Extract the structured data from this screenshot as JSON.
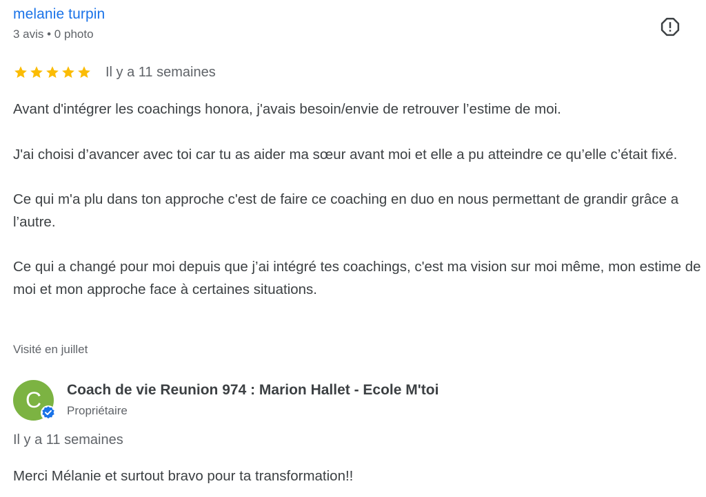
{
  "reviewer": {
    "name": "melanie turpin",
    "meta": "3 avis • 0 photo"
  },
  "report": {
    "icon": "report-icon"
  },
  "rating": {
    "value": 5,
    "max": 5,
    "star_color": "#fbbc04",
    "date": "Il y a 11 semaines"
  },
  "review": {
    "paragraphs": [
      "Avant d'intégrer les coachings honora, j'avais besoin/envie de retrouver l’estime de moi.",
      "J'ai choisi d’avancer avec toi car tu as aider ma sœur avant moi et elle a pu atteindre ce qu’elle c’était fixé.",
      "Ce qui m'a plu dans ton approche c'est de faire ce coaching en duo en nous permettant de grandir grâce a l’autre.",
      "Ce qui a changé pour moi depuis que j’ai intégré tes coachings, c'est ma vision sur moi même, mon estime de moi et mon approche face à certaines situations."
    ],
    "visited": "Visité en juillet"
  },
  "owner": {
    "avatar_letter": "C",
    "avatar_color": "#7cb342",
    "badge_color": "#1a73e8",
    "name": "Coach de vie Reunion 974 : Marion Hallet - Ecole M'toi",
    "role": "Propriétaire",
    "reply_date": "Il y a 11 semaines",
    "reply_text": "Merci Mélanie et surtout bravo pour ta transformation!!"
  }
}
